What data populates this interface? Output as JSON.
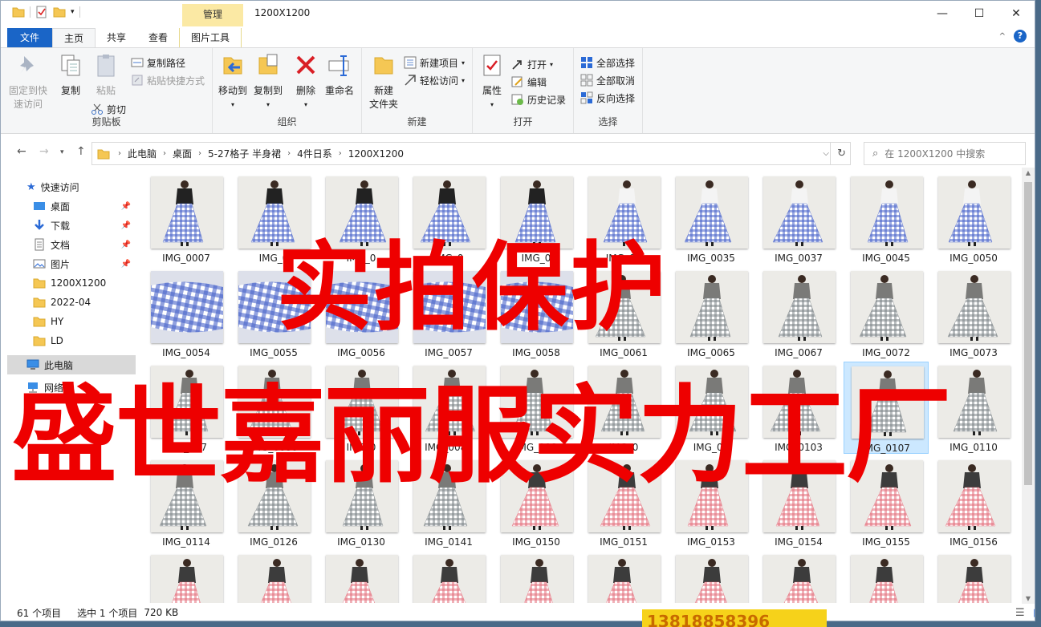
{
  "window": {
    "title": "1200X1200",
    "manage_tab": "管理",
    "controls": {
      "minimize": "—",
      "maximize": "☐",
      "close": "✕"
    }
  },
  "tabs": {
    "file": "文件",
    "home": "主页",
    "share": "共享",
    "view": "查看",
    "picture_tools": "图片工具"
  },
  "ribbon": {
    "clipboard": {
      "label": "剪贴板",
      "pin": "固定到快\n速访问",
      "copy": "复制",
      "paste": "粘贴",
      "copy_path": "复制路径",
      "paste_shortcut": "粘贴快捷方式",
      "cut": "剪切"
    },
    "organize": {
      "label": "组织",
      "move_to": "移动到",
      "copy_to": "复制到",
      "delete": "删除",
      "rename": "重命名"
    },
    "new": {
      "label": "新建",
      "new_folder": "新建\n文件夹",
      "new_item": "新建项目",
      "easy_access": "轻松访问"
    },
    "open": {
      "label": "打开",
      "properties": "属性",
      "open": "打开",
      "edit": "编辑",
      "history": "历史记录"
    },
    "select": {
      "label": "选择",
      "select_all": "全部选择",
      "select_none": "全部取消",
      "invert": "反向选择"
    }
  },
  "address": {
    "crumbs": [
      "此电脑",
      "桌面",
      "5-27格子 半身裙",
      "4件日系",
      "1200X1200"
    ],
    "search_placeholder": "在 1200X1200 中搜索"
  },
  "navpane": {
    "quick_access": "快速访问",
    "items": [
      {
        "label": "桌面",
        "pinned": true,
        "icon": "desktop-icon"
      },
      {
        "label": "下载",
        "pinned": true,
        "icon": "download-icon"
      },
      {
        "label": "文档",
        "pinned": true,
        "icon": "document-icon"
      },
      {
        "label": "图片",
        "pinned": true,
        "icon": "picture-icon"
      },
      {
        "label": "1200X1200",
        "pinned": false,
        "icon": "folder-icon"
      },
      {
        "label": "2022-04",
        "pinned": false,
        "icon": "folder-icon"
      },
      {
        "label": "HY",
        "pinned": false,
        "icon": "folder-icon"
      },
      {
        "label": "LD",
        "pinned": false,
        "icon": "folder-icon"
      }
    ],
    "this_pc": "此电脑",
    "network": "网络"
  },
  "files": [
    [
      "IMG_0007",
      "IMG_0",
      "IMG_0",
      "IMG_0",
      "IMG_0",
      "IMG_00",
      "IMG_0035",
      "IMG_0037",
      "IMG_0045",
      "IMG_0050"
    ],
    [
      "IMG_0054",
      "IMG_0055",
      "IMG_0056",
      "IMG_0057",
      "IMG_0058",
      "IMG_0061",
      "IMG_0065",
      "IMG_0067",
      "IMG_0072",
      "IMG_0073"
    ],
    [
      "IMG_007",
      "IMG_0080",
      "IMG_0",
      "IMG_0083",
      "IMG_008",
      "IMG_0",
      "IMG_01",
      "IMG_0103",
      "IMG_0107",
      "IMG_0110"
    ],
    [
      "IMG_0114",
      "IMG_0126",
      "IMG_0130",
      "IMG_0141",
      "IMG_0150",
      "IMG_0151",
      "IMG_0153",
      "IMG_0154",
      "IMG_0155",
      "IMG_0156"
    ],
    [
      "",
      "",
      "",
      "",
      "",
      "",
      "",
      "",
      "",
      ""
    ]
  ],
  "selected_file": "IMG_0107",
  "status": {
    "count": "61 个项目",
    "selected": "选中 1 个项目",
    "size": "720 KB"
  },
  "watermark": {
    "line1": "实拍保护",
    "line2": "盛世嘉丽服实力工厂",
    "phone": "13818858396",
    "color": "#ee0000"
  },
  "colors": {
    "accent": "#1a65c7",
    "manage": "#fbe9a4",
    "selection": "#cce8ff",
    "gingham_blue": "#4a64c9",
    "gingham_gray": "#7d8588",
    "gingham_red": "#e4707e"
  }
}
